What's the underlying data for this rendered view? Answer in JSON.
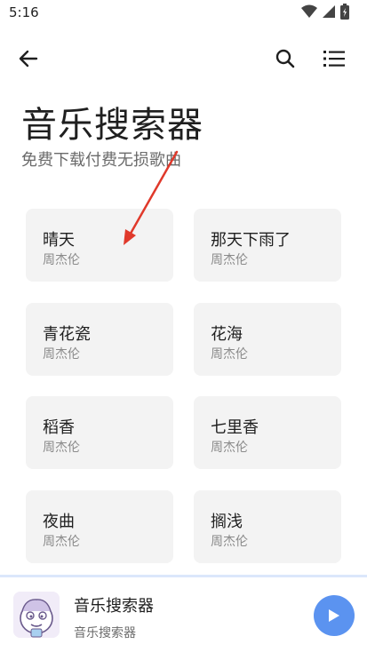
{
  "status_bar": {
    "time": "5:16",
    "icons": [
      "wifi-icon",
      "signal-icon",
      "battery-icon"
    ]
  },
  "app_bar": {
    "icons": [
      "back-arrow-icon",
      "search-icon",
      "list-menu-icon"
    ]
  },
  "page": {
    "title": "音乐搜索器",
    "subtitle": "免费下载付费无损歌曲"
  },
  "songs": [
    {
      "title": "晴天",
      "artist": "周杰伦"
    },
    {
      "title": "那天下雨了",
      "artist": "周杰伦"
    },
    {
      "title": "青花瓷",
      "artist": "周杰伦"
    },
    {
      "title": "花海",
      "artist": "周杰伦"
    },
    {
      "title": "稻香",
      "artist": "周杰伦"
    },
    {
      "title": "七里香",
      "artist": "周杰伦"
    },
    {
      "title": "夜曲",
      "artist": "周杰伦"
    },
    {
      "title": "搁浅",
      "artist": "周杰伦"
    }
  ],
  "player": {
    "title": "音乐搜索器",
    "subtitle": "音乐搜索器",
    "play_icon": "play-icon"
  },
  "colors": {
    "accent": "#5b93f0",
    "card_bg": "#f3f3f3",
    "annotation_arrow": "#e0392b"
  }
}
